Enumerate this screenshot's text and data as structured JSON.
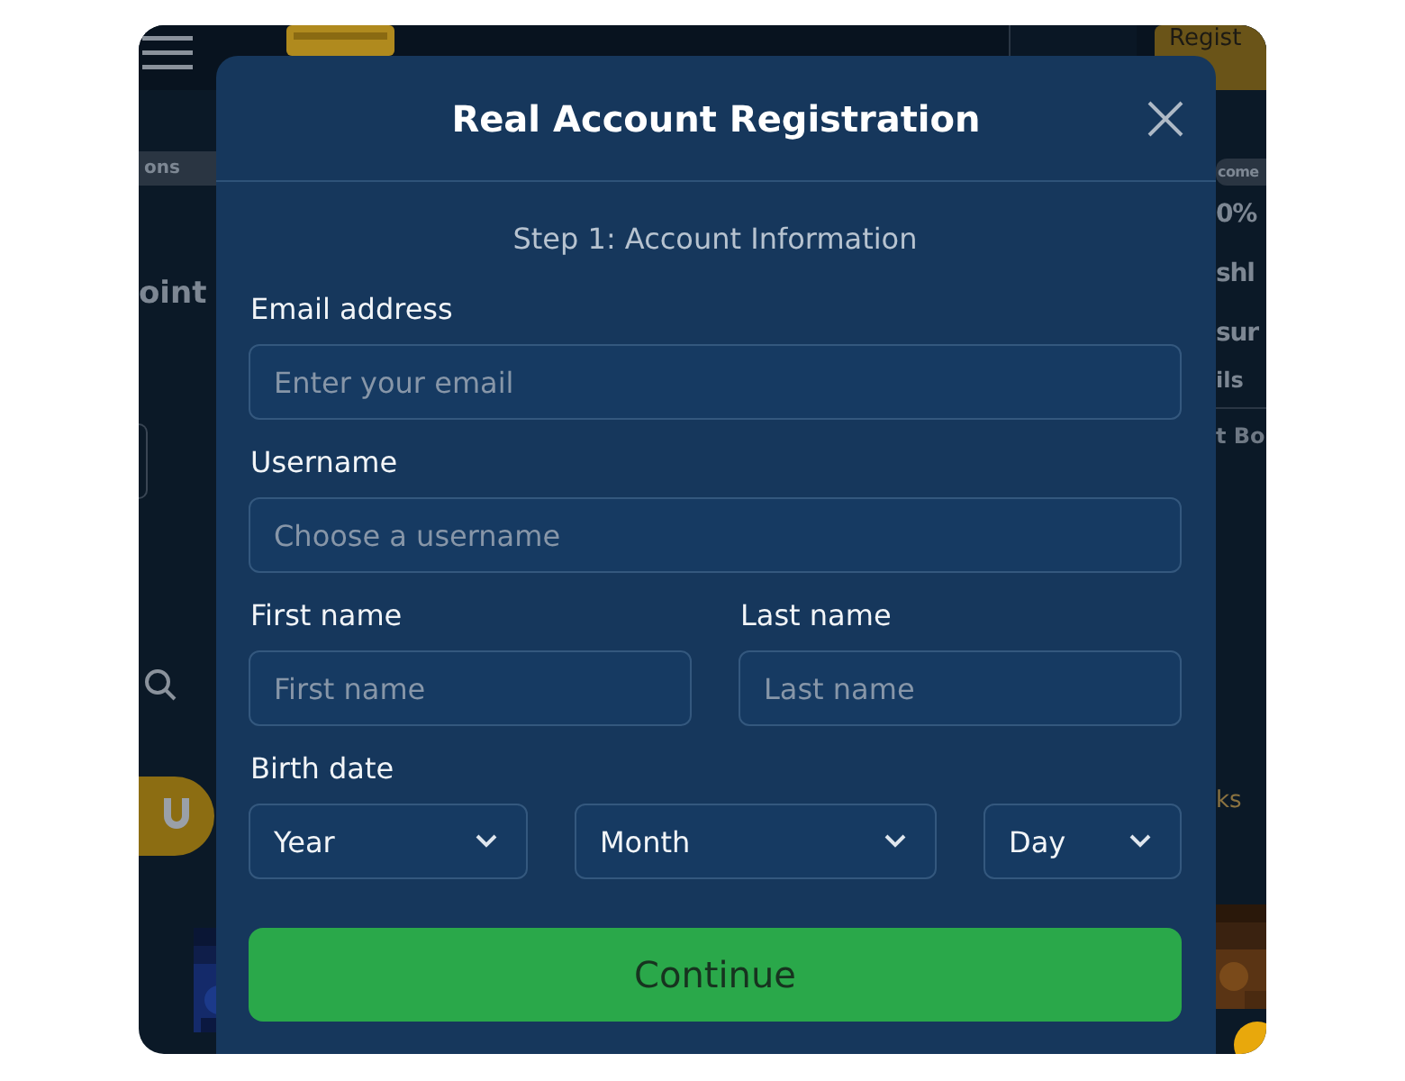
{
  "background": {
    "header": {
      "register": "Regist"
    },
    "left": [
      {
        "kind": "pill",
        "text": "ons"
      },
      {
        "kind": "headline",
        "text": "oint"
      },
      {
        "kind": "outline"
      },
      {
        "kind": "search"
      },
      {
        "kind": "badge"
      },
      {
        "kind": "picture"
      }
    ],
    "right": [
      {
        "kind": "pill",
        "text": "come"
      },
      {
        "kind": "headline",
        "text": "0%"
      },
      {
        "kind": "headline",
        "text": "shl"
      },
      {
        "kind": "headline",
        "text": "sur"
      },
      {
        "kind": "small",
        "text": "ils"
      },
      {
        "kind": "bold",
        "text": "t Bo"
      },
      {
        "kind": "gold",
        "text": "ks"
      },
      {
        "kind": "picture"
      }
    ]
  },
  "dialog": {
    "title": "Real Account Registration",
    "step": "Step 1: Account Information",
    "rows": [
      {
        "fields": [
          {
            "label": "Email address",
            "placeholder": "Enter your email"
          }
        ]
      },
      {
        "fields": [
          {
            "label": "Username",
            "placeholder": "Choose a username"
          }
        ]
      },
      {
        "fields": [
          {
            "label": "First name",
            "placeholder": "First name"
          },
          {
            "label": "Last name",
            "placeholder": "Last name"
          }
        ]
      }
    ],
    "birth_date": {
      "label": "Birth date",
      "selects": [
        "Year",
        "Month",
        "Day"
      ]
    },
    "button": "Continue"
  }
}
